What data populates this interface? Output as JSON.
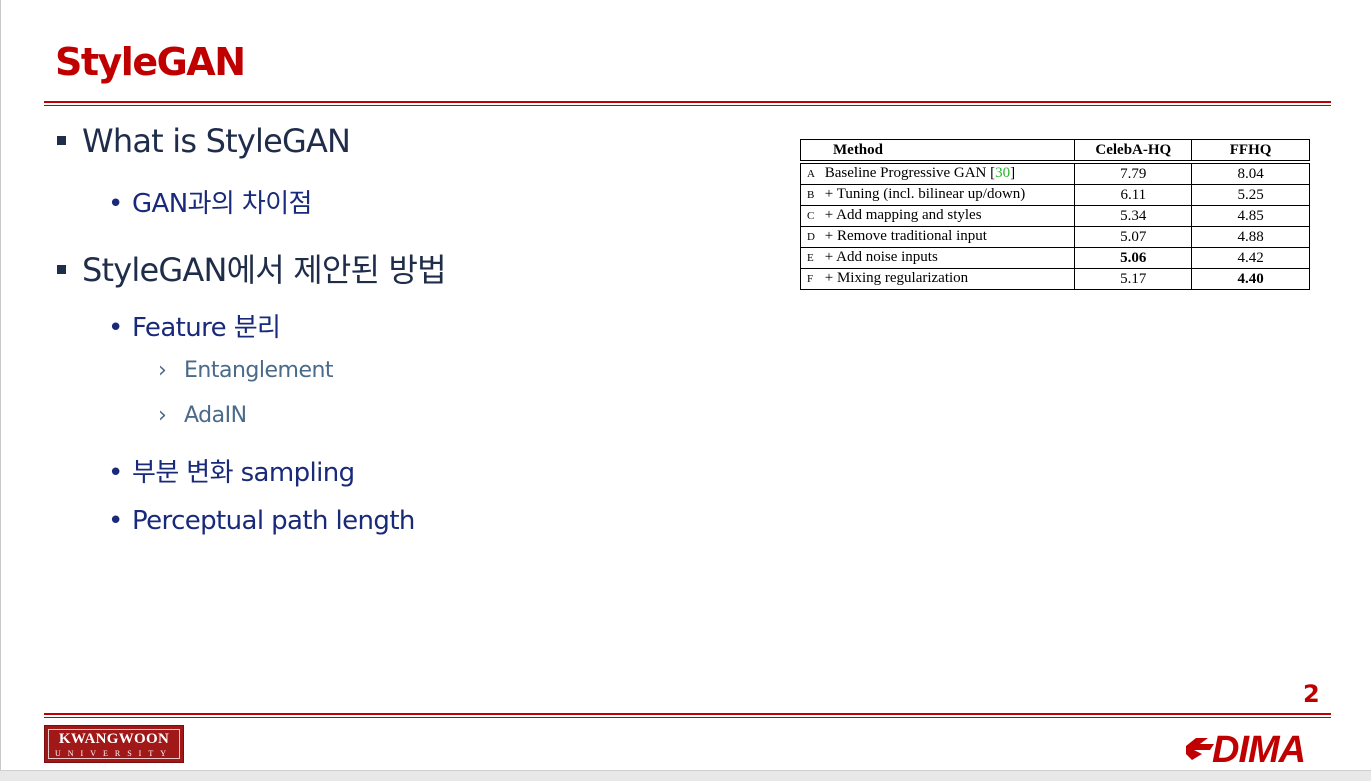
{
  "slide": {
    "title": "StyleGAN",
    "page_number": "2"
  },
  "bullets": {
    "b1": "What is StyleGAN",
    "b1_1": "GAN과의 차이점",
    "b2": "StyleGAN에서 제안된 방법",
    "b2_1": "Feature 분리",
    "b2_1_1": "Entanglement",
    "b2_1_2": "AdaIN",
    "b2_2": "부분 변화 sampling",
    "b2_3": "Perceptual path length"
  },
  "table": {
    "headers": [
      "Method",
      "CelebA-HQ",
      "FFHQ"
    ],
    "rows": [
      {
        "letter": "A",
        "method": "Baseline Progressive GAN [",
        "cite": "30",
        "method_end": "]",
        "celeba": "7.79",
        "ffhq": "8.04"
      },
      {
        "letter": "B",
        "method": "+ Tuning (incl. bilinear up/down)",
        "celeba": "6.11",
        "ffhq": "5.25"
      },
      {
        "letter": "C",
        "method": "+ Add mapping and styles",
        "celeba": "5.34",
        "ffhq": "4.85"
      },
      {
        "letter": "D",
        "method": "+ Remove traditional input",
        "celeba": "5.07",
        "ffhq": "4.88"
      },
      {
        "letter": "E",
        "method": "+ Add noise inputs",
        "celeba": "5.06",
        "ffhq": "4.42"
      },
      {
        "letter": "F",
        "method": "+ Mixing regularization",
        "celeba": "5.17",
        "ffhq": "4.40"
      }
    ]
  },
  "footer": {
    "univ_name": "KWANGWOON",
    "univ_sub": "UNIVERSITY",
    "lab_logo": "DIMA"
  },
  "colors": {
    "accent": "#c00000",
    "body_text": "#1f2d4a",
    "sub_text": "#1a2a7a",
    "sub_sub_text": "#4a6a8a",
    "cite": "#2bb32b"
  },
  "icons": {
    "level1_bullet": "square-bullet-icon",
    "level2_bullet": "dot-bullet-icon",
    "level3_bullet": "chevron-right-icon"
  }
}
